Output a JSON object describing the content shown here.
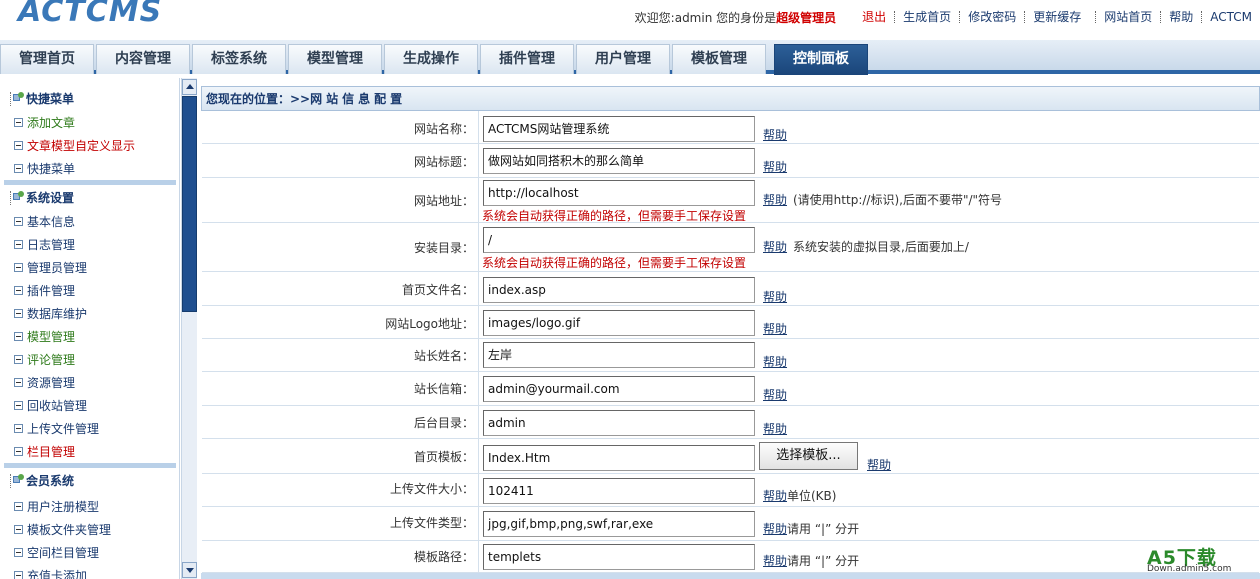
{
  "app": {
    "logo_text": "ACTCMS"
  },
  "topbar": {
    "welcome_prefix": "欢迎您:admin 您的身份是",
    "role": "超级管理员",
    "links": [
      "退出",
      "生成首页",
      "修改密码",
      "更新缓存",
      "网站首页",
      "帮助",
      "ACTCM"
    ]
  },
  "nav": {
    "tabs": [
      "管理首页",
      "内容管理",
      "标签系统",
      "模型管理",
      "生成操作",
      "插件管理",
      "用户管理",
      "模板管理",
      "控制面板"
    ],
    "active_index": 8
  },
  "sidebar": {
    "groups": [
      {
        "title": "快捷菜单",
        "items": [
          {
            "label": "添加文章",
            "color": "green"
          },
          {
            "label": "文章模型自定义显示",
            "color": "red"
          },
          {
            "label": "快捷菜单",
            "color": "default"
          }
        ]
      },
      {
        "title": "系统设置",
        "items": [
          {
            "label": "基本信息",
            "color": "default"
          },
          {
            "label": "日志管理",
            "color": "default"
          },
          {
            "label": "管理员管理",
            "color": "default"
          },
          {
            "label": "插件管理",
            "color": "default"
          },
          {
            "label": "数据库维护",
            "color": "default"
          },
          {
            "label": "模型管理",
            "color": "green"
          },
          {
            "label": "评论管理",
            "color": "green"
          },
          {
            "label": "资源管理",
            "color": "default"
          },
          {
            "label": "回收站管理",
            "color": "default"
          },
          {
            "label": "上传文件管理",
            "color": "default"
          },
          {
            "label": "栏目管理",
            "color": "red"
          }
        ]
      },
      {
        "title": "会员系统",
        "items": [
          {
            "label": "用户注册模型",
            "color": "default"
          },
          {
            "label": "模板文件夹管理",
            "color": "default"
          },
          {
            "label": "空间栏目管理",
            "color": "default"
          },
          {
            "label": "充值卡添加",
            "color": "default"
          }
        ]
      }
    ]
  },
  "breadcrumb": {
    "prefix": "您现在的位置：>>",
    "current": "网站信息配置"
  },
  "form": {
    "help_label": "帮助",
    "rows": [
      {
        "label": "网站名称：",
        "value": "ACTCMS网站管理系统"
      },
      {
        "label": "网站标题：",
        "value": "做网站如同搭积木的那么简单"
      },
      {
        "label": "网站地址：",
        "value": "http://localhost",
        "note": "系统会自动获得正确的路径，但需要手工保存设置",
        "hint": "(请使用http://标识),后面不要带\"/\"符号"
      },
      {
        "label": "安装目录：",
        "value": "/",
        "note": "系统会自动获得正确的路径，但需要手工保存设置",
        "hint": "系统安装的虚拟目录,后面要加上/"
      },
      {
        "label": "首页文件名：",
        "value": "index.asp"
      },
      {
        "label": "网站Logo地址：",
        "value": "images/logo.gif"
      },
      {
        "label": "站长姓名：",
        "value": "左岸"
      },
      {
        "label": "站长信箱：",
        "value": "admin@yourmail.com"
      },
      {
        "label": "后台目录：",
        "value": "admin"
      },
      {
        "label": "首页模板：",
        "value": "Index.Htm",
        "button": "选择模板..."
      },
      {
        "label": "上传文件大小：",
        "value": "102411",
        "hint": "单位(KB)"
      },
      {
        "label": "上传文件类型：",
        "value": "jpg,gif,bmp,png,swf,rar,exe",
        "hint": "请用 “|” 分开"
      },
      {
        "label": "模板路径：",
        "value": "templets",
        "hint": "请用 “|” 分开"
      }
    ]
  },
  "watermark": {
    "big": "A5下载",
    "small": "Down.admin5.com"
  },
  "colors": {
    "nav_active": "#1a4579",
    "link": "#1a3a6e",
    "warning": "#c20000",
    "green": "#2e7a1a"
  }
}
